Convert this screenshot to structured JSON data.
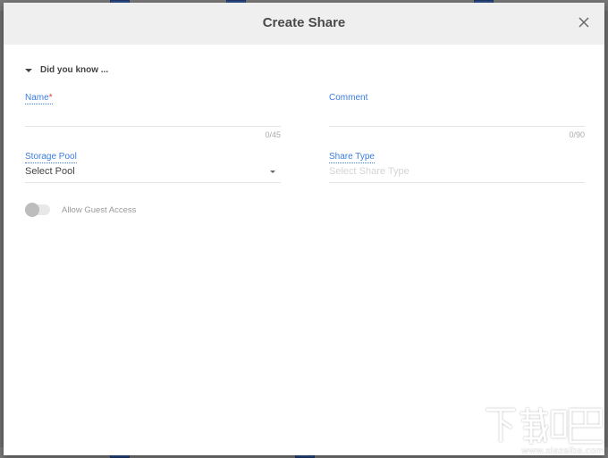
{
  "dialog": {
    "title": "Create Share",
    "close_icon": "close-icon"
  },
  "tips": {
    "label": "Did you know ...",
    "icon": "caret-down-icon"
  },
  "form": {
    "name": {
      "label": "Name",
      "required_mark": "*",
      "value": "",
      "counter": "0/45"
    },
    "comment": {
      "label": "Comment",
      "value": "",
      "counter": "0/90"
    },
    "storage_pool": {
      "label": "Storage Pool",
      "selected": "Select Pool"
    },
    "share_type": {
      "label": "Share Type",
      "placeholder": "Select Share Type"
    },
    "guest_access": {
      "label": "Allow Guest Access",
      "enabled": false
    }
  },
  "watermark": {
    "text": "下载吧",
    "url": "www.xiazaiba.com"
  },
  "colors": {
    "accent": "#3b7ddd",
    "required": "#e53935",
    "header_bg": "#efefef"
  }
}
